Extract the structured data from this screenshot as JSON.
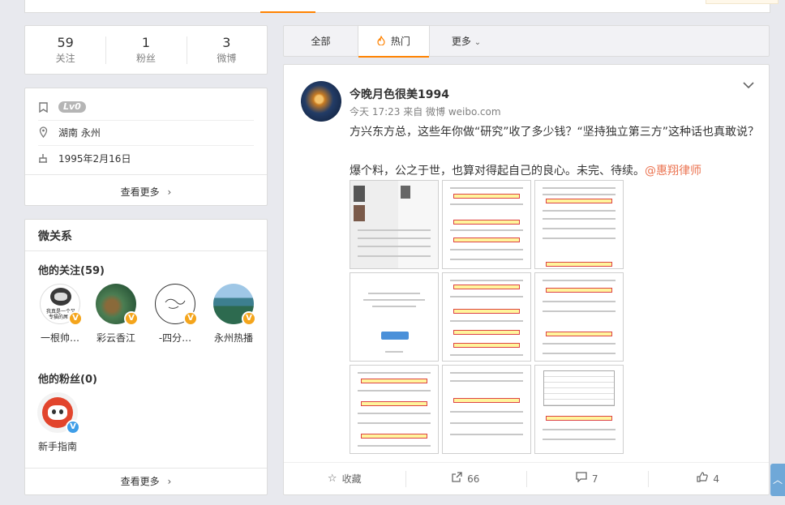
{
  "stats": [
    {
      "num": "59",
      "label": "关注"
    },
    {
      "num": "1",
      "label": "粉丝"
    },
    {
      "num": "3",
      "label": "微博"
    }
  ],
  "info": {
    "level": "Lv0",
    "location": "湖南 永州",
    "birthday": "1995年2月16日",
    "more": "查看更多"
  },
  "relations": {
    "title": "微关系",
    "following_title": "他的关注(59)",
    "following": [
      {
        "name": "一根帅…",
        "avatar_text": "我真是一个又\n专猫的屌丝",
        "badge": "V",
        "badge_color": "#f4a51c"
      },
      {
        "name": "彩云香江",
        "avatar_text": "",
        "badge": "V",
        "badge_color": "#f4a51c"
      },
      {
        "name": "-四分…",
        "avatar_text": "",
        "badge": "V",
        "badge_color": "#f4a51c"
      },
      {
        "name": "永州热播",
        "avatar_text": "",
        "badge": "V",
        "badge_color": "#f4a51c"
      }
    ],
    "fans_title": "他的粉丝(0)",
    "fans": [
      {
        "name": "新手指南",
        "badge": "V",
        "badge_color": "#3f9ee8"
      }
    ],
    "more": "查看更多"
  },
  "feed_tabs": {
    "all": "全部",
    "hot": "热门",
    "more": "更多"
  },
  "post": {
    "username": "今晚月色很美1994",
    "meta": "今天 17:23 来自 微博 weibo.com",
    "text_line1": "方兴东方总，这些年你做“研究”收了多少钱？“坚持独立第三方”这种话也真敢说？",
    "text_line2": "爆个料，公之于世，也算对得起自己的良心。未完、待续。",
    "mention": "@惠翔律师",
    "actions": {
      "favorite": "收藏",
      "repost": "66",
      "comment": "7",
      "like": "4"
    }
  },
  "icons": {
    "level": "bookmark-icon",
    "location": "location-pin-icon",
    "birthday": "cake-icon"
  }
}
